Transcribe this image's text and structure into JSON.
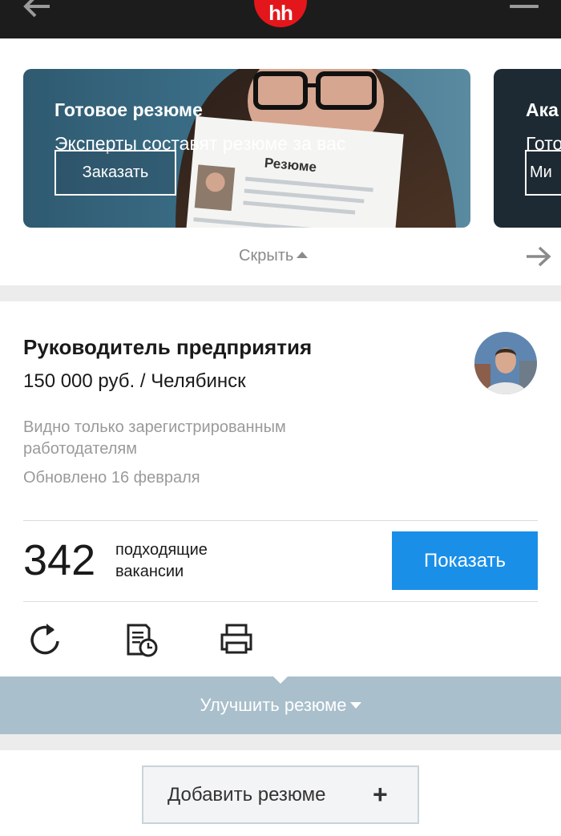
{
  "header": {
    "logo_text": "hh",
    "back_icon": "arrow-left-icon",
    "menu_icon": "hamburger-menu-icon"
  },
  "promo": {
    "banners": [
      {
        "title": "Готовое резюме",
        "subtitle": "Эксперты составят резюме за вас",
        "button_label": "Заказать",
        "doc_label": "Резюме"
      },
      {
        "title": "Ака",
        "subtitle": "Гото",
        "button_label": "Ми"
      }
    ],
    "hide_label": "Скрыть",
    "next_icon": "arrow-right-icon"
  },
  "resume": {
    "title": "Руководитель предприятия",
    "salary_city": "150 000 руб. / Челябинск",
    "visibility": "Видно только зарегистрированным работодателям",
    "updated": "Обновлено 16 февраля",
    "vacancies_count": "342",
    "vacancies_label": "подходящие вакансии",
    "show_button": "Показать",
    "improve_label": "Улучшить резюме"
  },
  "add": {
    "label": "Добавить резюме",
    "plus": "+"
  },
  "colors": {
    "topbar": "#1c1c1c",
    "logo": "#e3161b",
    "primary_button": "#1a8fe8",
    "improve_bar": "#a9bfcb"
  }
}
